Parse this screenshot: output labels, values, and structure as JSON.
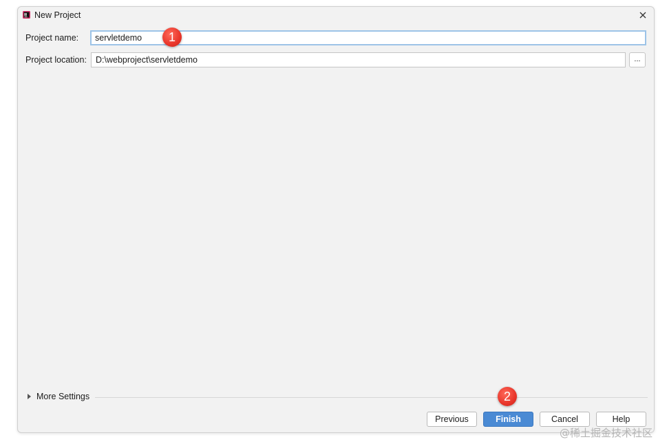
{
  "window": {
    "title": "New Project",
    "app_icon": "intellij-idea-icon",
    "close_icon": "close-icon"
  },
  "form": {
    "project_name_label": "Project name:",
    "project_name_value": "servletdemo",
    "project_location_label": "Project location:",
    "project_location_value": "D:\\webproject\\servletdemo",
    "browse_label": "..."
  },
  "annotations": {
    "step1": "1",
    "step2": "2"
  },
  "more_settings": {
    "label": "More Settings"
  },
  "buttons": {
    "previous": "Previous",
    "finish": "Finish",
    "cancel": "Cancel",
    "help": "Help"
  },
  "watermark": "@稀土掘金技术社区",
  "colors": {
    "accent": "#4a8ad4",
    "badge": "#e8352a",
    "focus_border": "#9cc3e7"
  }
}
